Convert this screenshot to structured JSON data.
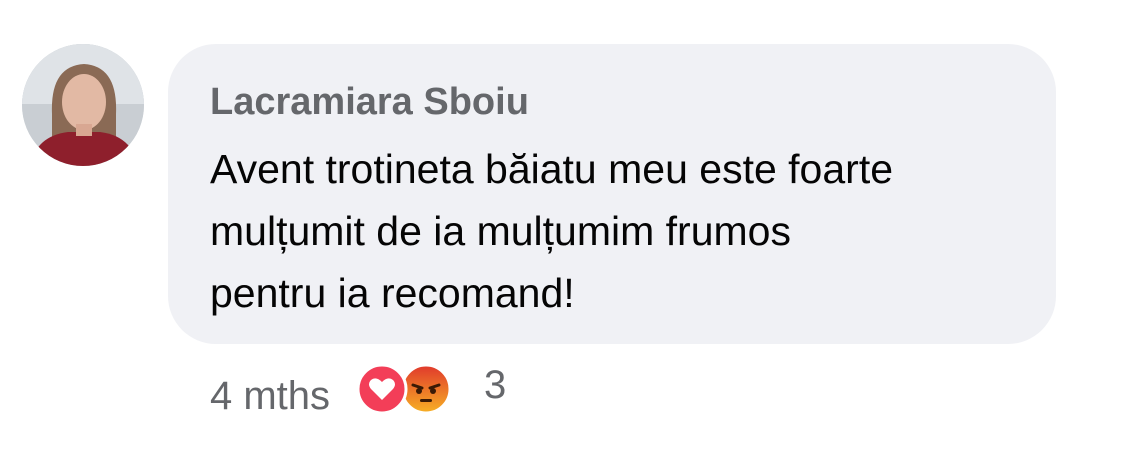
{
  "comment": {
    "author": "Lacramiara Sboiu",
    "text_lines": [
      "Avent trotineta băiatu meu este foarte",
      "mulțumit de ia mulțumim frumos",
      "pentru ia recomand!"
    ],
    "timestamp": "4 mths",
    "reactions": {
      "icons": [
        "love-reaction-icon",
        "angry-reaction-icon"
      ],
      "count": "3"
    }
  },
  "colors": {
    "bubble_bg": "#f0f1f5",
    "author": "#65676b",
    "text": "#050505",
    "meta": "#65676b",
    "love": "#f33e58",
    "angry": "#e9710f"
  }
}
